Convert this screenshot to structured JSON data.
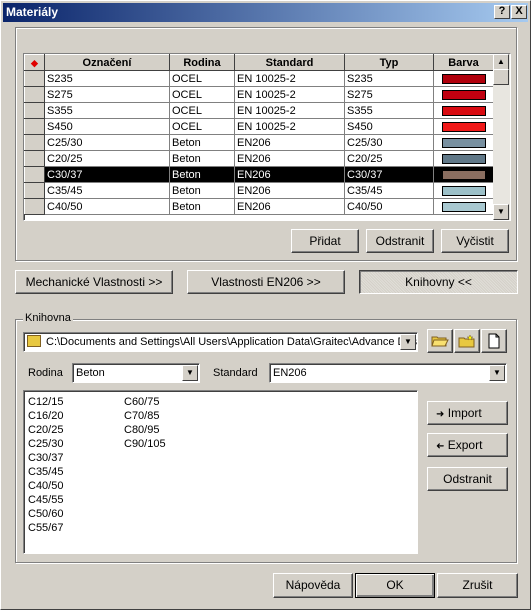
{
  "window": {
    "title": "Materiály",
    "help_btn": "?",
    "close_btn": "X"
  },
  "table": {
    "headers": [
      "",
      "Označení",
      "Rodina",
      "Standard",
      "Typ",
      "Barva"
    ],
    "rows": [
      {
        "name": "S235",
        "rodina": "OCEL",
        "standard": "EN 10025-2",
        "typ": "S235",
        "color": "#b0000c"
      },
      {
        "name": "S275",
        "rodina": "OCEL",
        "standard": "EN 10025-2",
        "typ": "S275",
        "color": "#c00010"
      },
      {
        "name": "S355",
        "rodina": "OCEL",
        "standard": "EN 10025-2",
        "typ": "S355",
        "color": "#d80a10"
      },
      {
        "name": "S450",
        "rodina": "OCEL",
        "standard": "EN 10025-2",
        "typ": "S450",
        "color": "#f01818"
      },
      {
        "name": "C25/30",
        "rodina": "Beton",
        "standard": "EN206",
        "typ": "C25/30",
        "color": "#7890a0"
      },
      {
        "name": "C20/25",
        "rodina": "Beton",
        "standard": "EN206",
        "typ": "C20/25",
        "color": "#607888"
      },
      {
        "name": "C30/37",
        "rodina": "Beton",
        "standard": "EN206",
        "typ": "C30/37",
        "color": "#8a6e60"
      },
      {
        "name": "C35/45",
        "rodina": "Beton",
        "standard": "EN206",
        "typ": "C35/45",
        "color": "#9cc0c8"
      },
      {
        "name": "C40/50",
        "rodina": "Beton",
        "standard": "EN206",
        "typ": "C40/50",
        "color": "#a8c8d0"
      }
    ],
    "selected_row": 6
  },
  "table_buttons": {
    "add": "Přidat",
    "remove": "Odstranit",
    "clear": "Vyčistit"
  },
  "tabs": {
    "mech": "Mechanické Vlastnosti >>",
    "en206": "Vlastnosti EN206 >>",
    "library": "Knihovny <<"
  },
  "library": {
    "group_label": "Knihovna",
    "path": "C:\\Documents and Settings\\All Users\\Application Data\\Graitec\\Advance Design",
    "rodina_label": "Rodina",
    "rodina_value": "Beton",
    "standard_label": "Standard",
    "standard_value": "EN206",
    "items_col1": [
      "C12/15",
      "C16/20",
      "C20/25",
      "C25/30",
      "C30/37",
      "C35/45",
      "C40/50",
      "C45/55",
      "C50/60",
      "C55/67"
    ],
    "items_col2": [
      "C60/75",
      "C70/85",
      "C80/95",
      "C90/105"
    ],
    "import": "Import",
    "export": "Export",
    "remove": "Odstranit"
  },
  "footer": {
    "help": "Nápověda",
    "ok": "OK",
    "cancel": "Zrušit"
  }
}
